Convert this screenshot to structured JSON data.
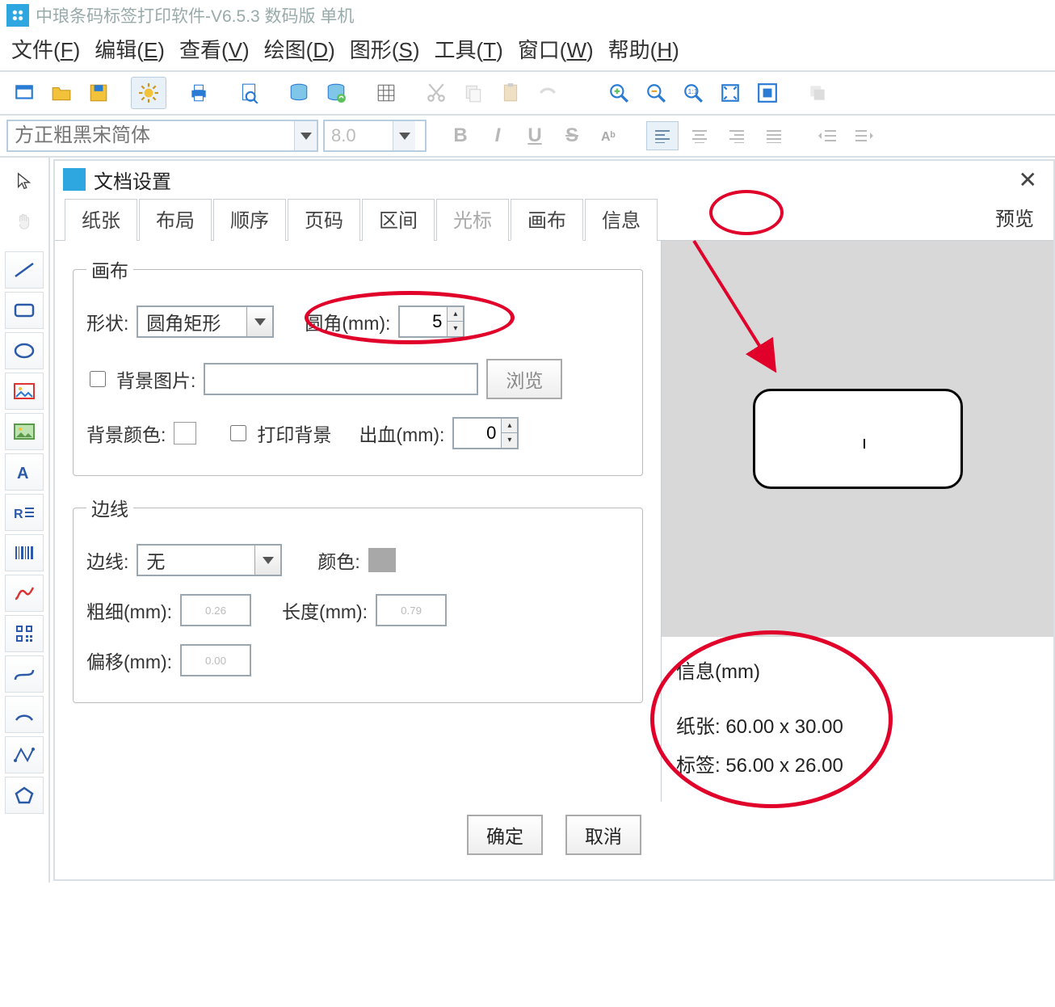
{
  "titlebar": {
    "title": "中琅条码标签打印软件-V6.5.3 数码版 单机"
  },
  "menu": {
    "file": {
      "label": "文件",
      "hotkey": "F"
    },
    "edit": {
      "label": "编辑",
      "hotkey": "E"
    },
    "view": {
      "label": "查看",
      "hotkey": "V"
    },
    "draw": {
      "label": "绘图",
      "hotkey": "D"
    },
    "shape": {
      "label": "图形",
      "hotkey": "S"
    },
    "tools": {
      "label": "工具",
      "hotkey": "T"
    },
    "window": {
      "label": "窗口",
      "hotkey": "W"
    },
    "help": {
      "label": "帮助",
      "hotkey": "H"
    }
  },
  "font_bar": {
    "font_placeholder": "方正粗黑宋简体",
    "size_value": "8.0",
    "bold": "B",
    "italic": "I",
    "underline": "U",
    "strike": "S"
  },
  "dialog": {
    "title": "文档设置",
    "tabs": {
      "paper": "纸张",
      "layout": "布局",
      "order": "顺序",
      "page": "页码",
      "range": "区间",
      "cursor": "光标",
      "canvas": "画布",
      "info": "信息"
    },
    "preview_label": "预览",
    "canvas_group": {
      "legend": "画布",
      "shape_label": "形状:",
      "shape_value": "圆角矩形",
      "corner_label": "圆角(mm):",
      "corner_value": "5",
      "bg_image_label": "背景图片:",
      "bg_image_value": "",
      "browse_btn": "浏览",
      "bg_color_label": "背景颜色:",
      "print_bg_label": "打印背景",
      "bleed_label": "出血(mm):",
      "bleed_value": "0"
    },
    "border_group": {
      "legend": "边线",
      "border_label": "边线:",
      "border_value": "无",
      "color_label": "颜色:",
      "thickness_label": "粗细(mm):",
      "thickness_value": "0.26",
      "length_label": "长度(mm):",
      "length_value": "0.79",
      "offset_label": "偏移(mm):",
      "offset_value": "0.00"
    },
    "info_box": {
      "header": "信息(mm)",
      "paper_row": "纸张: 60.00 x 30.00",
      "label_row": "标签: 56.00 x 26.00"
    },
    "ok": "确定",
    "cancel": "取消"
  }
}
